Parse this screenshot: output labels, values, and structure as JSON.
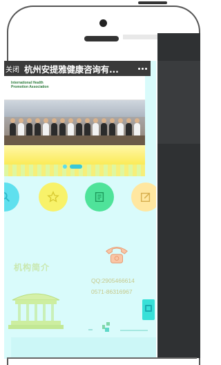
{
  "window": {
    "close_label": "关闭",
    "title": "杭州安提雅健康咨询有..."
  },
  "banner": {
    "logo_line1": "International Health",
    "logo_line2": "Promotion Association",
    "carousel_dots": 3,
    "active_dot": 2
  },
  "shortcuts": [
    {
      "icon": "search-icon",
      "color": "#5fe0ee"
    },
    {
      "icon": "star-icon",
      "color": "#f8f26a"
    },
    {
      "icon": "document-icon",
      "color": "#4fe39a"
    },
    {
      "icon": "edit-icon",
      "color": "#ffe7a0"
    }
  ],
  "about": {
    "title": "机构简介"
  },
  "contact": {
    "qq": "QQ:2905466614",
    "tel": "0571-86316967"
  }
}
